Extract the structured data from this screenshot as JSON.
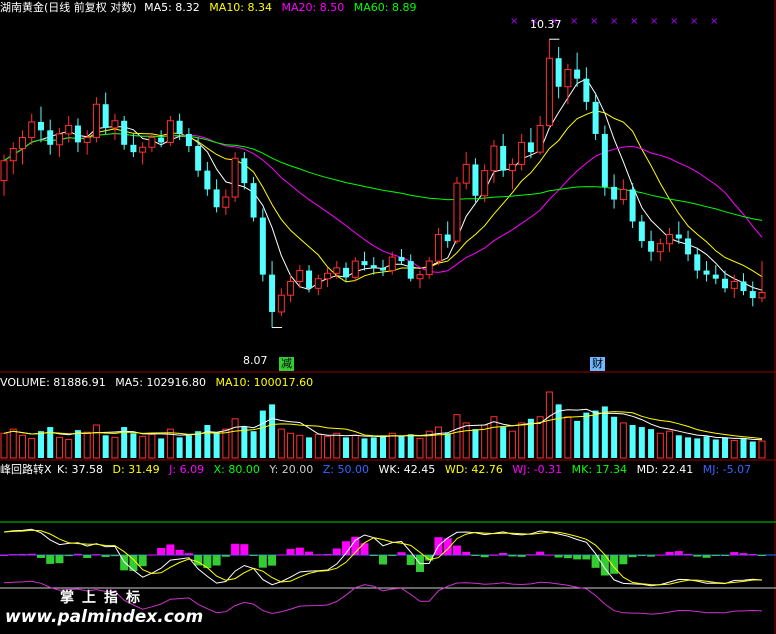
{
  "price_panel": {
    "title": "湖南黄金(日线 前复权 对数)",
    "ma5_label": "MA5: 8.32",
    "ma10_label": "MA10: 8.34",
    "ma20_label": "MA20: 8.50",
    "ma60_label": "MA60: 8.89",
    "high_marker": "10.37",
    "low_marker": "8.07",
    "badge_reduce": "减",
    "badge_finance": "财"
  },
  "volume_panel": {
    "volume_label": "VOLUME: 81886.91",
    "ma5_label": "MA5: 102916.80",
    "ma10_label": "MA10: 100017.60"
  },
  "indicator_panel": {
    "name": "峰回路转X",
    "k": "K: 37.58",
    "d": "D: 31.49",
    "j": "J: 6.09",
    "x": "X: 80.00",
    "y": "Y: 20.00",
    "z": "Z: 50.00",
    "wk": "WK: 42.45",
    "wd": "WD: 42.76",
    "wj": "WJ: -0.31",
    "mk": "MK: 17.34",
    "md": "MD: 22.41",
    "mj": "MJ: -5.07"
  },
  "watermark": {
    "line1": "掌上指标",
    "line2": "www.palmindex.com"
  },
  "colors": {
    "up": "#ff3030",
    "down": "#54ffff",
    "ma5": "#ffffff",
    "ma10": "#ffff00",
    "ma20": "#ff00ff",
    "ma60": "#00ff00",
    "magenta": "#ff00ff",
    "green_bar": "#33cc33"
  },
  "chart_data": [
    {
      "type": "candlestick",
      "title": "湖南黄金(日线 前复权 对数)",
      "y_scale": "log",
      "ylim": [
        7.9,
        10.6
      ],
      "annotations": [
        {
          "label": "10.37",
          "value": 10.37,
          "kind": "high"
        },
        {
          "label": "8.07",
          "value": 8.07,
          "kind": "low"
        }
      ],
      "ohlc": [
        [
          9.17,
          9.38,
          9.05,
          9.33
        ],
        [
          9.33,
          9.48,
          9.22,
          9.43
        ],
        [
          9.43,
          9.58,
          9.3,
          9.52
        ],
        [
          9.52,
          9.72,
          9.46,
          9.65
        ],
        [
          9.65,
          9.78,
          9.48,
          9.58
        ],
        [
          9.58,
          9.67,
          9.38,
          9.46
        ],
        [
          9.46,
          9.6,
          9.36,
          9.55
        ],
        [
          9.55,
          9.7,
          9.48,
          9.62
        ],
        [
          9.62,
          9.68,
          9.4,
          9.48
        ],
        [
          9.48,
          9.58,
          9.38,
          9.52
        ],
        [
          9.52,
          9.86,
          9.48,
          9.8
        ],
        [
          9.8,
          9.9,
          9.55,
          9.6
        ],
        [
          9.6,
          9.72,
          9.5,
          9.66
        ],
        [
          9.66,
          9.7,
          9.42,
          9.46
        ],
        [
          9.46,
          9.55,
          9.36,
          9.4
        ],
        [
          9.4,
          9.48,
          9.3,
          9.44
        ],
        [
          9.44,
          9.56,
          9.4,
          9.52
        ],
        [
          9.52,
          9.58,
          9.44,
          9.48
        ],
        [
          9.48,
          9.7,
          9.45,
          9.66
        ],
        [
          9.66,
          9.72,
          9.5,
          9.55
        ],
        [
          9.55,
          9.6,
          9.4,
          9.45
        ],
        [
          9.45,
          9.52,
          9.2,
          9.25
        ],
        [
          9.25,
          9.32,
          9.05,
          9.1
        ],
        [
          9.1,
          9.18,
          8.92,
          8.96
        ],
        [
          8.96,
          9.1,
          8.9,
          9.04
        ],
        [
          9.04,
          9.4,
          9.0,
          9.35
        ],
        [
          9.35,
          9.4,
          9.1,
          9.15
        ],
        [
          9.15,
          9.2,
          8.85,
          8.88
        ],
        [
          8.88,
          8.95,
          8.4,
          8.45
        ],
        [
          8.45,
          8.55,
          8.07,
          8.18
        ],
        [
          8.18,
          8.35,
          8.15,
          8.3
        ],
        [
          8.3,
          8.45,
          8.25,
          8.4
        ],
        [
          8.4,
          8.52,
          8.35,
          8.48
        ],
        [
          8.48,
          8.52,
          8.32,
          8.35
        ],
        [
          8.35,
          8.45,
          8.3,
          8.42
        ],
        [
          8.42,
          8.5,
          8.36,
          8.46
        ],
        [
          8.46,
          8.55,
          8.42,
          8.5
        ],
        [
          8.5,
          8.54,
          8.4,
          8.43
        ],
        [
          8.43,
          8.58,
          8.4,
          8.55
        ],
        [
          8.55,
          8.62,
          8.48,
          8.52
        ],
        [
          8.52,
          8.58,
          8.45,
          8.5
        ],
        [
          8.5,
          8.56,
          8.44,
          8.48
        ],
        [
          8.48,
          8.62,
          8.45,
          8.58
        ],
        [
          8.58,
          8.64,
          8.52,
          8.55
        ],
        [
          8.55,
          8.6,
          8.4,
          8.42
        ],
        [
          8.42,
          8.48,
          8.35,
          8.45
        ],
        [
          8.45,
          8.58,
          8.42,
          8.55
        ],
        [
          8.55,
          8.8,
          8.52,
          8.75
        ],
        [
          8.75,
          8.85,
          8.65,
          8.7
        ],
        [
          8.7,
          9.2,
          8.68,
          9.15
        ],
        [
          9.15,
          9.4,
          9.1,
          9.3
        ],
        [
          9.3,
          9.35,
          9.0,
          9.05
        ],
        [
          9.05,
          9.3,
          9.0,
          9.25
        ],
        [
          9.25,
          9.5,
          9.15,
          9.45
        ],
        [
          9.45,
          9.55,
          9.2,
          9.25
        ],
        [
          9.25,
          9.35,
          9.1,
          9.3
        ],
        [
          9.3,
          9.55,
          9.25,
          9.48
        ],
        [
          9.48,
          9.6,
          9.35,
          9.4
        ],
        [
          9.4,
          9.7,
          9.38,
          9.62
        ],
        [
          9.62,
          10.37,
          9.6,
          10.2
        ],
        [
          10.2,
          10.3,
          9.85,
          9.95
        ],
        [
          9.95,
          10.15,
          9.8,
          10.1
        ],
        [
          10.1,
          10.25,
          9.95,
          10.02
        ],
        [
          10.02,
          10.12,
          9.75,
          9.82
        ],
        [
          9.82,
          9.9,
          9.5,
          9.55
        ],
        [
          9.55,
          9.62,
          9.05,
          9.12
        ],
        [
          9.12,
          9.22,
          8.95,
          9.02
        ],
        [
          9.02,
          9.18,
          8.98,
          9.1
        ],
        [
          9.1,
          9.15,
          8.8,
          8.85
        ],
        [
          8.85,
          8.9,
          8.65,
          8.7
        ],
        [
          8.7,
          8.78,
          8.55,
          8.62
        ],
        [
          8.62,
          8.72,
          8.55,
          8.68
        ],
        [
          8.68,
          8.8,
          8.62,
          8.75
        ],
        [
          8.75,
          8.85,
          8.68,
          8.72
        ],
        [
          8.72,
          8.78,
          8.55,
          8.6
        ],
        [
          8.6,
          8.65,
          8.42,
          8.48
        ],
        [
          8.48,
          8.55,
          8.4,
          8.45
        ],
        [
          8.45,
          8.52,
          8.38,
          8.42
        ],
        [
          8.42,
          8.48,
          8.32,
          8.35
        ],
        [
          8.35,
          8.45,
          8.28,
          8.4
        ],
        [
          8.4,
          8.46,
          8.3,
          8.33
        ],
        [
          8.33,
          8.4,
          8.22,
          8.28
        ],
        [
          8.28,
          8.55,
          8.25,
          8.32
        ]
      ],
      "series": [
        {
          "name": "MA5",
          "value": 8.32
        },
        {
          "name": "MA10",
          "value": 8.34
        },
        {
          "name": "MA20",
          "value": 8.5
        },
        {
          "name": "MA60",
          "value": 8.89
        }
      ]
    },
    {
      "type": "bar",
      "title": "VOLUME",
      "ylim": [
        0,
        320000
      ],
      "values": [
        120,
        140,
        110,
        95,
        130,
        150,
        100,
        90,
        135,
        125,
        160,
        110,
        100,
        150,
        120,
        105,
        115,
        95,
        140,
        100,
        110,
        130,
        160,
        125,
        140,
        190,
        150,
        130,
        230,
        260,
        140,
        120,
        110,
        100,
        115,
        105,
        120,
        100,
        110,
        95,
        100,
        110,
        120,
        105,
        115,
        95,
        130,
        150,
        120,
        210,
        170,
        140,
        160,
        200,
        150,
        130,
        170,
        190,
        200,
        320,
        260,
        200,
        180,
        220,
        230,
        250,
        200,
        170,
        160,
        150,
        140,
        120,
        130,
        110,
        100,
        95,
        105,
        90,
        100,
        85,
        95,
        80,
        82
      ],
      "value_unit": "thousand",
      "series": [
        {
          "name": "VOLUME",
          "value": 81886.91
        },
        {
          "name": "MA5",
          "value": 102916.8
        },
        {
          "name": "MA10",
          "value": 100017.6
        }
      ]
    },
    {
      "type": "line",
      "title": "峰回路转X",
      "ylim": [
        -20,
        120
      ],
      "series": [
        {
          "name": "K",
          "value": 37.58
        },
        {
          "name": "D",
          "value": 31.49
        },
        {
          "name": "J",
          "value": 6.09
        },
        {
          "name": "X",
          "value": 80.0
        },
        {
          "name": "Y",
          "value": 20.0
        },
        {
          "name": "Z",
          "value": 50.0
        },
        {
          "name": "WK",
          "value": 42.45
        },
        {
          "name": "WD",
          "value": 42.76
        },
        {
          "name": "WJ",
          "value": -0.31
        },
        {
          "name": "MK",
          "value": 17.34
        },
        {
          "name": "MD",
          "value": 22.41
        },
        {
          "name": "MJ",
          "value": -5.07
        }
      ]
    }
  ]
}
